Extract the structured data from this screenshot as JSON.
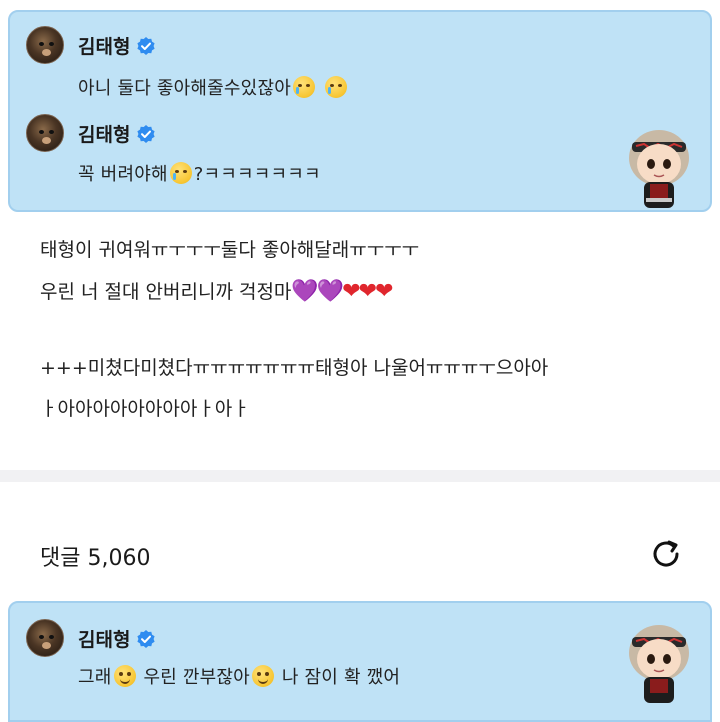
{
  "top_card": {
    "messages": [
      {
        "author": "김태형",
        "text_before": "아니 둘다 좋아해줄수있잖아",
        "emojis": [
          "crying-face",
          "crying-face"
        ],
        "text_after": ""
      },
      {
        "author": "김태형",
        "text_before": "꼭 버려야해",
        "emojis": [
          "crying-face"
        ],
        "text_after": "?ㅋㅋㅋㅋㅋㅋㅋ"
      }
    ]
  },
  "post": {
    "line1": "태형이 귀여워ㅠㅜㅜㅜ둘다 좋아해달래ㅠㅜㅜㅜ",
    "line2_text": "우린 너 절대 안버리니까 걱정마",
    "line2_hearts_purple": "💜💜",
    "line2_hearts_red": "❤❤❤",
    "line3": "+++미쳤다미쳤다ㅠㅠㅠㅠㅠㅠㅠ태형아 나울어ㅠㅠㅠㅜ으아아",
    "line4": "ㅏ아아아아아아아아ㅏ아ㅏ"
  },
  "comments": {
    "label": "댓글 5,060",
    "refresh_icon": "refresh-icon"
  },
  "bottom_card": {
    "author": "김태형",
    "part1": "그래",
    "part2": "우린 깐부잖아",
    "part3": "나 잠이 확 깼어",
    "emoji": "slightly-smiling-face"
  },
  "colors": {
    "card_bg": "#bfe2f6",
    "card_border": "#a2cfee",
    "verified_blue": "#2f8cf0",
    "heart_purple": "#a64ef2",
    "heart_red": "#e0262d"
  }
}
